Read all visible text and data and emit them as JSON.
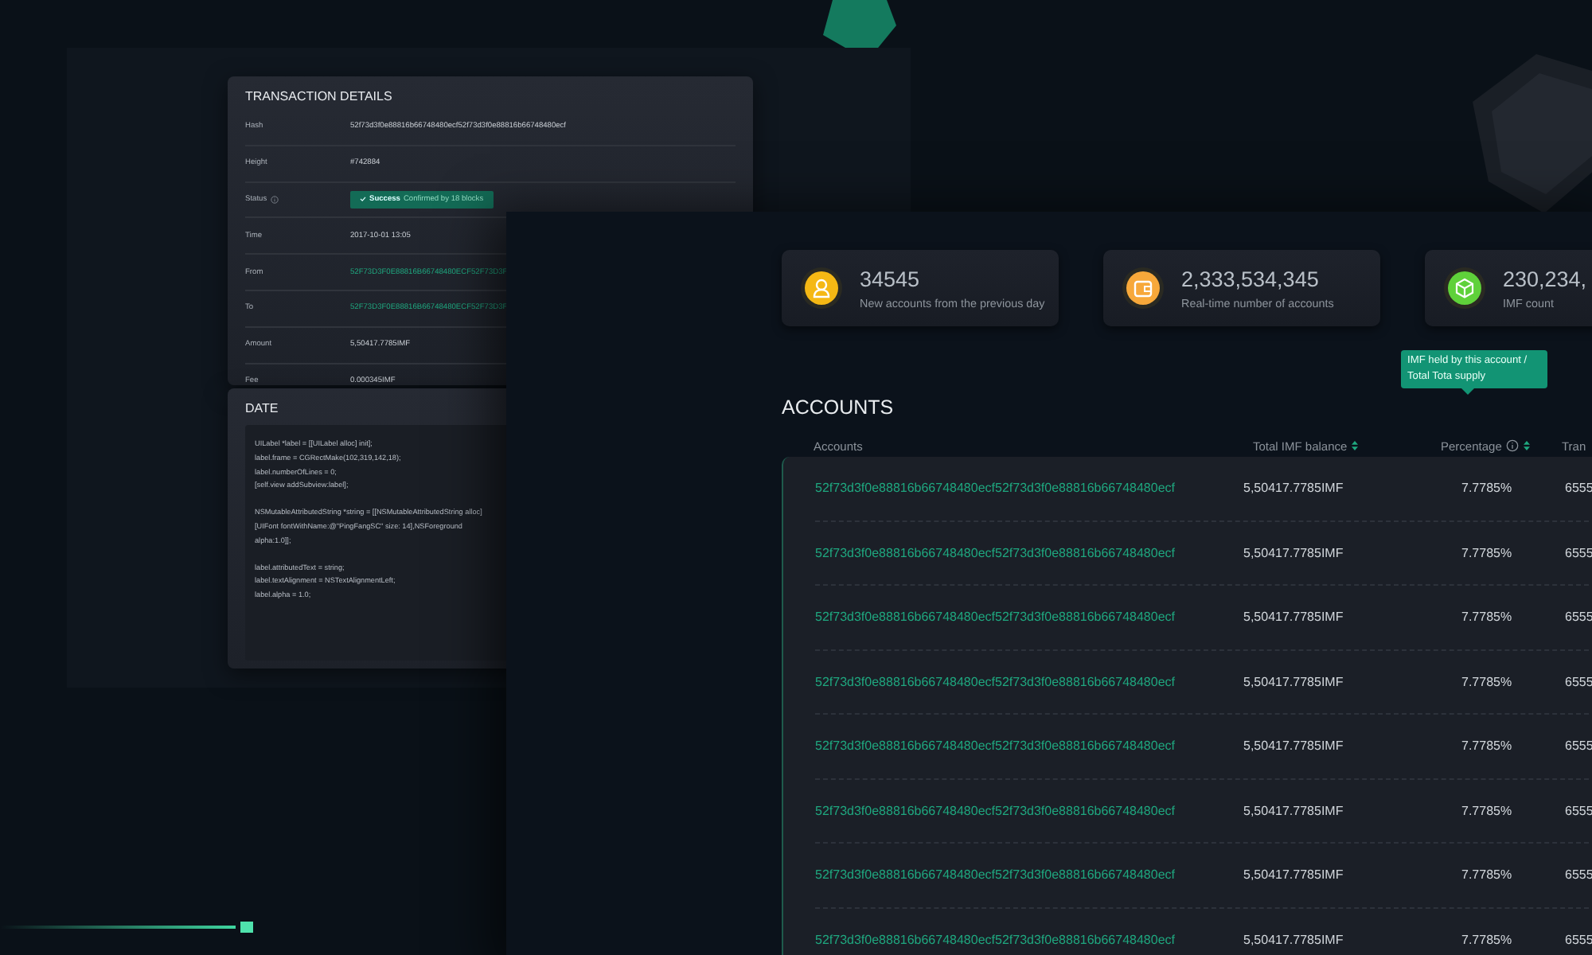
{
  "transaction_details": {
    "title": "TRANSACTION DETAILS",
    "rows": [
      {
        "label": "Hash",
        "value": "52f73d3f0e88816b66748480ecf52f73d3f0e88816b66748480ecf",
        "kind": "text"
      },
      {
        "label": "Height",
        "value": "#742884",
        "kind": "text"
      },
      {
        "label": "Status",
        "value": "Success",
        "note": "Confirmed by 18 blocks",
        "kind": "badge"
      },
      {
        "label": "Time",
        "value": "2017-10-01  13:05",
        "kind": "text"
      },
      {
        "label": "From",
        "value": "52F73D3F0E88816B66748480ECF52F73D3F",
        "kind": "link"
      },
      {
        "label": "To",
        "value": "52F73D3F0E88816B66748480ECF52F73D3F",
        "kind": "link"
      },
      {
        "label": "Amount",
        "value": "5,50417.7785IMF",
        "kind": "text"
      },
      {
        "label": "Fee",
        "value": "0.000345IMF",
        "kind": "text"
      }
    ]
  },
  "date_panel": {
    "title": "DATE",
    "code_blocks": [
      [
        "UILabel *label = [[UILabel alloc] init];",
        "label.frame = CGRectMake(102,319,142,18);",
        "label.numberOfLines = 0;",
        "[self.view addSubview:label];"
      ],
      [
        "NSMutableAttributedString *string = [[NSMutableAttributedString alloc]",
        "[UIFont fontWithName:@\"PingFangSC\" size: 14],NSForeground",
        "alpha:1.0]];"
      ],
      [
        "label.attributedText = string;",
        "label.textAlignment = NSTextAlignmentLeft;",
        "label.alpha = 1.0;"
      ]
    ]
  },
  "stats": [
    {
      "value": "34545",
      "label": "New accounts from the previous day",
      "kind": "user",
      "color": "#f5b814"
    },
    {
      "value": "2,333,534,345",
      "label": "Real-time number of accounts",
      "kind": "wallet",
      "color": "#f7a83a"
    },
    {
      "value": "230,234,",
      "label": "IMF count",
      "kind": "cube",
      "color": "#5fd13a"
    }
  ],
  "accounts": {
    "title": "ACCOUNTS",
    "tooltip": "IMF held by this account / Total Tota supply",
    "columns": [
      {
        "label": "Accounts",
        "sortable": false,
        "info": false
      },
      {
        "label": "Total IMF balance",
        "sortable": true,
        "info": false
      },
      {
        "label": "Percentage",
        "sortable": true,
        "info": true
      },
      {
        "label": "Tran"
      }
    ],
    "rows": [
      {
        "account": "52f73d3f0e88816b66748480ecf52f73d3f0e88816b66748480ecf",
        "balance": "5,50417.7785IMF",
        "percentage": "7.7785%",
        "column_4": "6555"
      },
      {
        "account": "52f73d3f0e88816b66748480ecf52f73d3f0e88816b66748480ecf",
        "balance": "5,50417.7785IMF",
        "percentage": "7.7785%",
        "column_4": "6555"
      },
      {
        "account": "52f73d3f0e88816b66748480ecf52f73d3f0e88816b66748480ecf",
        "balance": "5,50417.7785IMF",
        "percentage": "7.7785%",
        "column_4": "6555"
      },
      {
        "account": "52f73d3f0e88816b66748480ecf52f73d3f0e88816b66748480ecf",
        "balance": "5,50417.7785IMF",
        "percentage": "7.7785%",
        "column_4": "6555"
      },
      {
        "account": "52f73d3f0e88816b66748480ecf52f73d3f0e88816b66748480ecf",
        "balance": "5,50417.7785IMF",
        "percentage": "7.7785%",
        "column_4": "6555"
      },
      {
        "account": "52f73d3f0e88816b66748480ecf52f73d3f0e88816b66748480ecf",
        "balance": "5,50417.7785IMF",
        "percentage": "7.7785%",
        "column_4": "6555"
      },
      {
        "account": "52f73d3f0e88816b66748480ecf52f73d3f0e88816b66748480ecf",
        "balance": "5,50417.7785IMF",
        "percentage": "7.7785%",
        "column_4": "6555"
      },
      {
        "account": "52f73d3f0e88816b66748480ecf52f73d3f0e88816b66748480ecf",
        "balance": "5,50417.7785IMF",
        "percentage": "7.7785%",
        "column_4": "6555"
      }
    ]
  }
}
